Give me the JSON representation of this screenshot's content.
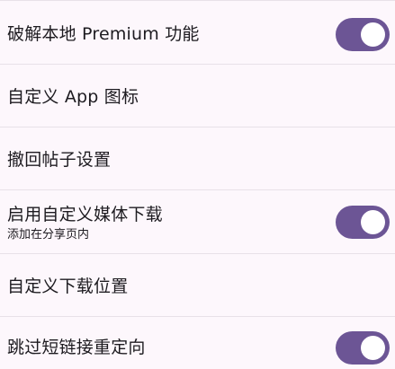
{
  "settings": {
    "items": [
      {
        "title": "破解本地 Premium 功能",
        "subtitle": "",
        "toggle": true,
        "checked": true
      },
      {
        "title": "自定义 App 图标",
        "subtitle": "",
        "toggle": false
      },
      {
        "title": "撤回帖子设置",
        "subtitle": "",
        "toggle": false
      },
      {
        "title": "启用自定义媒体下载",
        "subtitle": "添加在分享页内",
        "toggle": true,
        "checked": true
      },
      {
        "title": "自定义下载位置",
        "subtitle": "",
        "toggle": false
      },
      {
        "title": "跳过短链接重定向",
        "subtitle": "",
        "toggle": true,
        "checked": true
      }
    ]
  },
  "colors": {
    "background": "#fdf7fc",
    "switch_track_on": "#6c5595",
    "switch_thumb": "#ffffff",
    "divider": "#e8e1e8"
  }
}
